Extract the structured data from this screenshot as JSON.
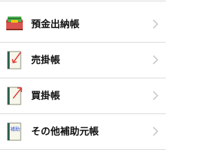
{
  "list": {
    "items": [
      {
        "label": "預金出納帳",
        "icon": "cashbook-icon"
      },
      {
        "label": "売掛帳",
        "icon": "receivables-ledger-icon"
      },
      {
        "label": "買掛帳",
        "icon": "payables-ledger-icon"
      },
      {
        "label": "その他補助元帳",
        "icon": "other-subledger-icon",
        "icon_text": "補助"
      }
    ]
  },
  "colors": {
    "chevron": "#c7c7cc",
    "separator": "#d8d8d8",
    "arrow": "#e53935",
    "icon_text": "#3a5bd9"
  }
}
